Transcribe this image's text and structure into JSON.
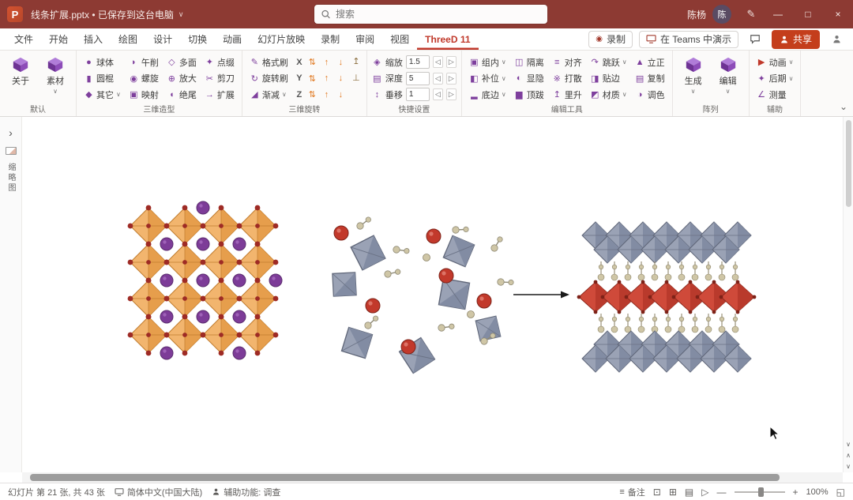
{
  "colors": {
    "titlebar": "#8d3a33",
    "share_button": "#c43e1c",
    "active_tab": "#c0392b"
  },
  "titlebar": {
    "app_initial": "P",
    "title": "线条扩展.pptx • 已保存到这台电脑",
    "title_chevron": "∨",
    "search_placeholder": "搜索",
    "user_name": "陈杨",
    "avatar_initial": "陈",
    "pen_icon": "✎",
    "minimize": "—",
    "maximize": "□",
    "close": "×"
  },
  "tabs": {
    "items": [
      "文件",
      "开始",
      "插入",
      "绘图",
      "设计",
      "切换",
      "动画",
      "幻灯片放映",
      "录制",
      "审阅",
      "视图",
      "ThreeD 11"
    ],
    "record_icon": "◉",
    "record": "录制",
    "teams": "在 Teams 中演示",
    "share": "共享"
  },
  "ribbon": {
    "collapse_icon": "⌄",
    "default_group": {
      "label": "默认",
      "buttons": [
        {
          "label": "关于",
          "chevron": ""
        },
        {
          "label": "素材",
          "chevron": "∨"
        }
      ]
    },
    "modeling": {
      "label": "三维造型",
      "cols": [
        [
          {
            "label": "球体",
            "icon": "●"
          },
          {
            "label": "圆棍",
            "icon": "▮"
          },
          {
            "label": "其它",
            "icon": "◆",
            "chevron": "∨"
          }
        ],
        [
          {
            "label": "午削",
            "icon": "◗"
          },
          {
            "label": "螺旋",
            "icon": "◉"
          },
          {
            "label": "映射",
            "icon": "▣"
          }
        ],
        [
          {
            "label": "多面",
            "icon": "◇"
          },
          {
            "label": "放大",
            "icon": "⊕"
          },
          {
            "label": "绝尾",
            "icon": "◖"
          }
        ],
        [
          {
            "label": "点缀",
            "icon": "✦"
          },
          {
            "label": "剪刀",
            "icon": "✂"
          },
          {
            "label": "扩展",
            "icon": "→"
          }
        ]
      ]
    },
    "rotation": {
      "label": "三维旋转",
      "brushes": [
        {
          "label": "格式刷",
          "icon": "✎"
        },
        {
          "label": "旋转刷",
          "icon": "↻"
        },
        {
          "label": "渐减",
          "icon": "◢",
          "chevron": "∨"
        }
      ],
      "axes": [
        "X",
        "Y",
        "Z"
      ],
      "arrow_icons": [
        "⇅",
        "↑",
        "↓"
      ],
      "extra_icons": [
        "↥",
        "⊥"
      ]
    },
    "quick": {
      "label": "快捷设置",
      "rows": [
        {
          "label": "缩放",
          "icon": "◈",
          "value": "1.5"
        },
        {
          "label": "深度",
          "icon": "▤",
          "value": "5"
        },
        {
          "label": "垂移",
          "icon": "↕",
          "value": "1"
        }
      ],
      "decrement_icon": "◁",
      "increment_icon": "▷"
    },
    "edit": {
      "label": "编辑工具",
      "cols": [
        [
          {
            "label": "组内",
            "icon": "▣",
            "chevron": "∨"
          },
          {
            "label": "补位",
            "icon": "◧",
            "chevron": "∨"
          },
          {
            "label": "底边",
            "icon": "▂",
            "chevron": "∨"
          }
        ],
        [
          {
            "label": "隔离",
            "icon": "◫"
          },
          {
            "label": "显隐",
            "icon": "◐"
          },
          {
            "label": "顶跋",
            "icon": "▆"
          }
        ],
        [
          {
            "label": "对齐",
            "icon": "≡"
          },
          {
            "label": "打散",
            "icon": "※"
          },
          {
            "label": "里升",
            "icon": "↥"
          }
        ],
        [
          {
            "label": "跳跃",
            "icon": "↷",
            "chevron": "∨"
          },
          {
            "label": "贴边",
            "icon": "◨"
          },
          {
            "label": "材质",
            "icon": "◩",
            "chevron": "∨"
          }
        ],
        [
          {
            "label": "立正",
            "icon": "▲"
          },
          {
            "label": "复制",
            "icon": "▤"
          },
          {
            "label": "调色",
            "icon": "◑"
          }
        ]
      ]
    },
    "array_group": {
      "label": "阵列",
      "buttons": [
        {
          "label": "生成",
          "chevron": "∨"
        },
        {
          "label": "编辑",
          "chevron": "∨"
        }
      ]
    },
    "aux": {
      "label": "辅助",
      "items": [
        {
          "label": "动画",
          "icon": "▶",
          "chevron": "∨"
        },
        {
          "label": "后期",
          "icon": "✦",
          "chevron": "∨"
        },
        {
          "label": "测量",
          "icon": "∠",
          "chevron": ""
        }
      ]
    }
  },
  "leftpane": {
    "expand_icon": "›",
    "thumbnails_label": "缩略图"
  },
  "scrollbar": {
    "vscroll_down": "∨",
    "prev_slide": "∧",
    "next_slide": "∨"
  },
  "statusbar": {
    "slide_info": "幻灯片 第 21 张, 共 43 张",
    "language": "简体中文(中国大陆)",
    "accessibility": "辅助功能: 调查",
    "notes_icon": "≡",
    "notes": "备注",
    "view_icons": [
      "⊡",
      "⊞",
      "▤",
      "▷"
    ],
    "zoom_out": "—",
    "zoom_in": "+",
    "zoom_level": "100%",
    "fit_icon": "◱"
  }
}
